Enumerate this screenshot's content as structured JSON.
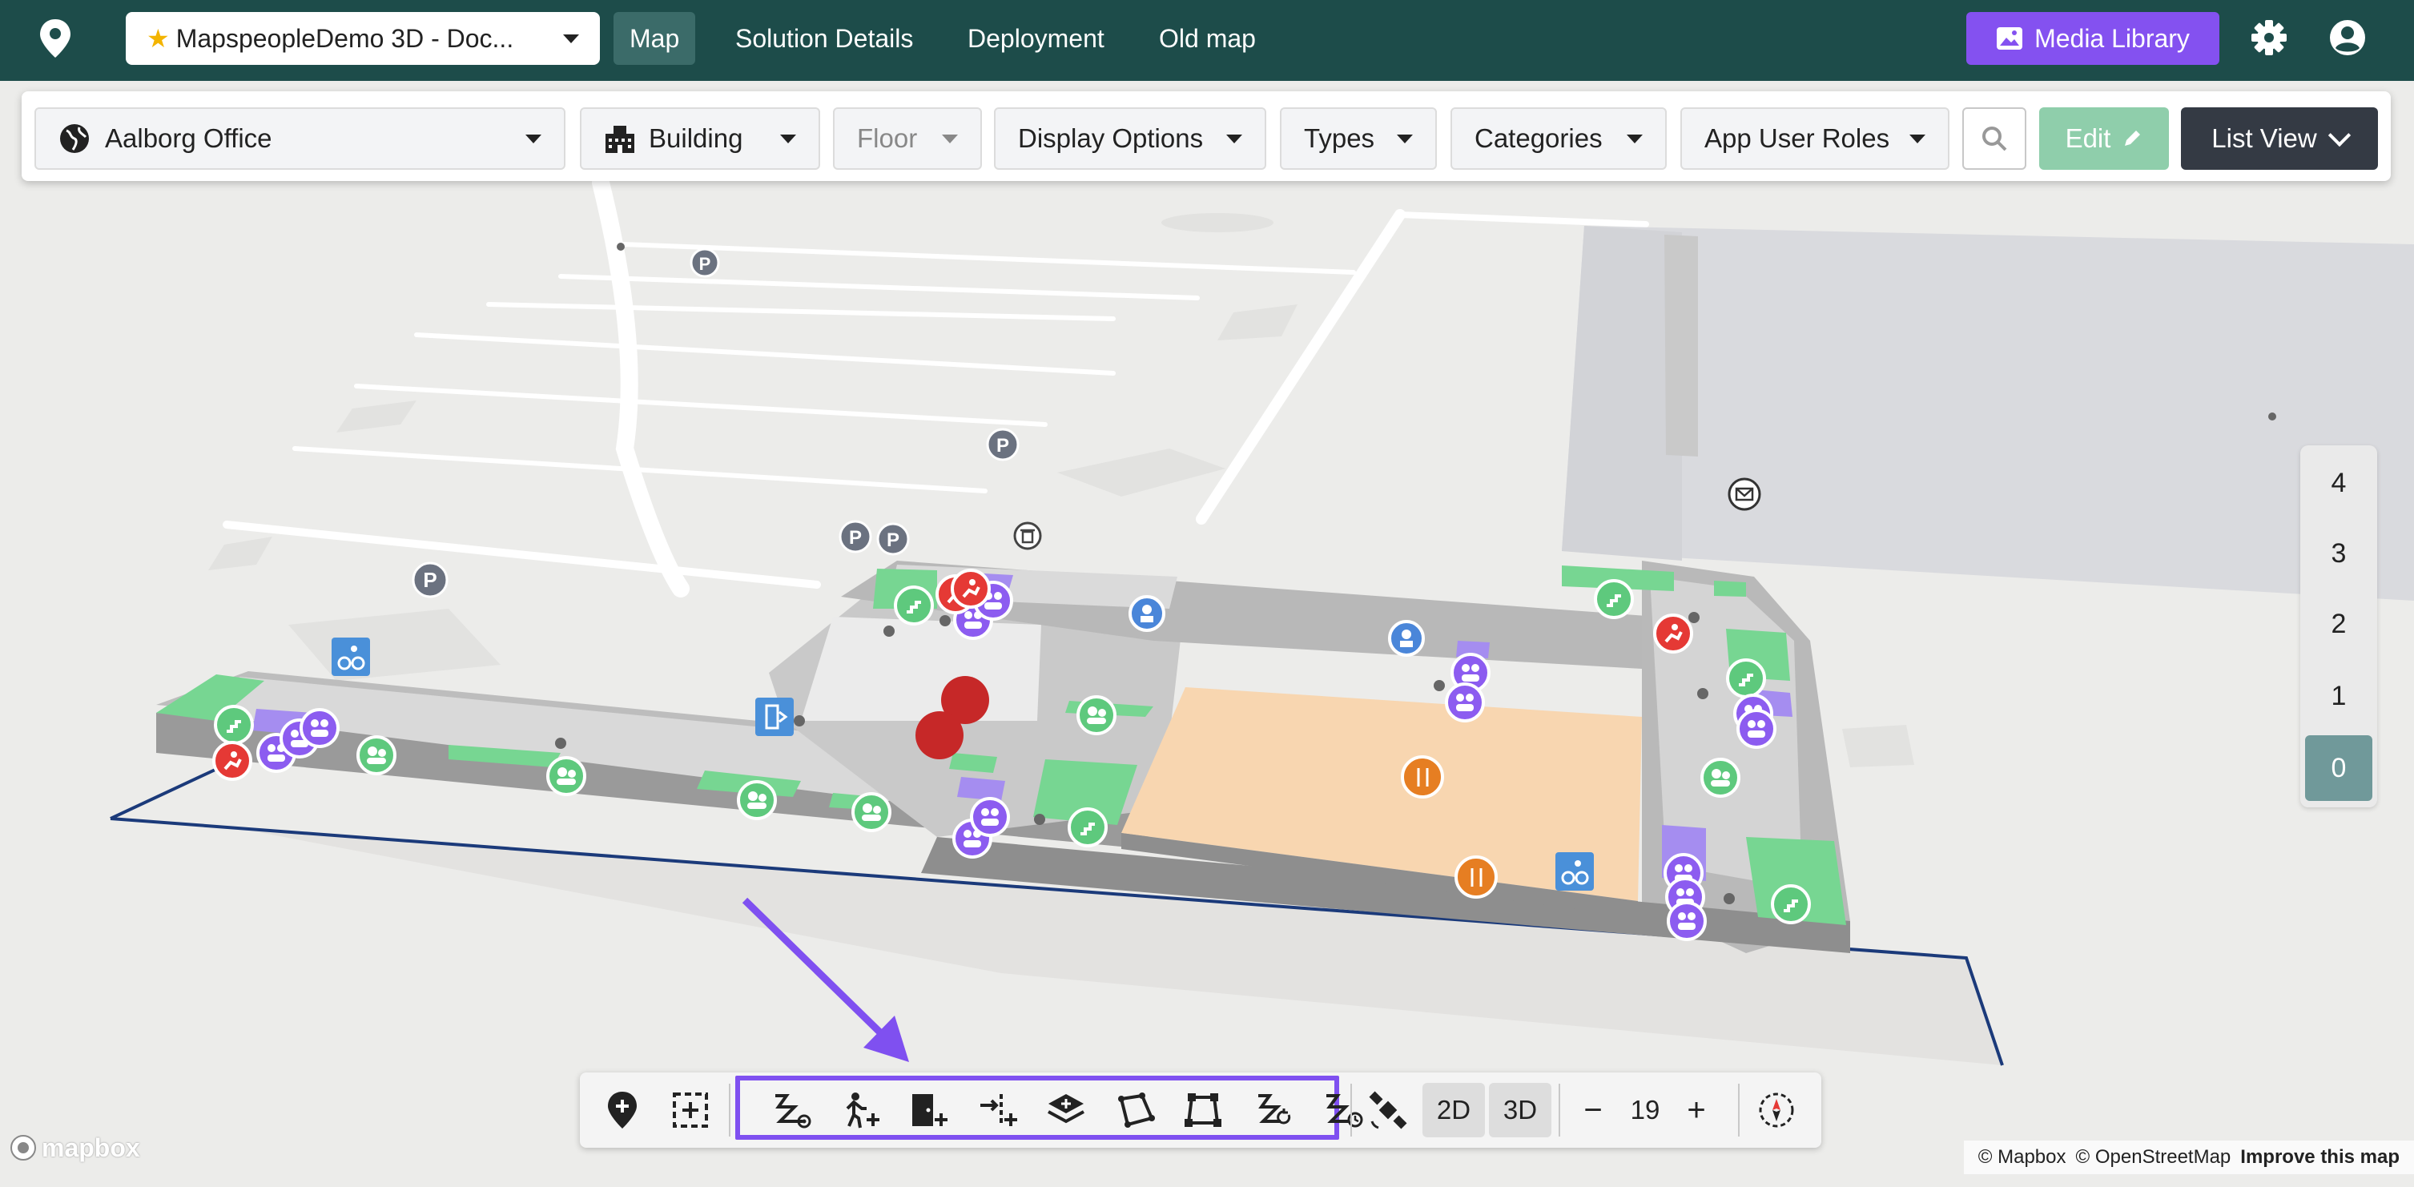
{
  "topbar": {
    "project": "MapspeopleDemo 3D - Doc...",
    "tabs": [
      "Map",
      "Solution Details",
      "Deployment",
      "Old map"
    ],
    "active_tab": "Map",
    "media_library": "Media Library"
  },
  "filters": {
    "venue": "Aalborg Office",
    "building": "Building",
    "floor": "Floor",
    "display_options": "Display Options",
    "types": "Types",
    "categories": "Categories",
    "app_user_roles": "App User Roles",
    "edit": "Edit",
    "list_view": "List View"
  },
  "floor_selector": {
    "floors": [
      "4",
      "3",
      "2",
      "1",
      "0"
    ],
    "selected": "0"
  },
  "bottom_toolbar": {
    "view_2d": "2D",
    "view_3d": "3D",
    "zoom": "19",
    "zoom_out": "−",
    "zoom_in": "+"
  },
  "map": {
    "parking_label": "P"
  },
  "attribution": {
    "mapbox": "© Mapbox",
    "osm": "© OpenStreetMap",
    "improve": "Improve this map",
    "logo": "mapbox"
  },
  "colors": {
    "topbar": "#1d4c4a",
    "accent_purple": "#8451f0",
    "restroom_green": "#5ec97d",
    "meeting_purple": "#8c5cf0",
    "canteen_orange": "#f8d6b0",
    "floor_active": "#70999a"
  }
}
